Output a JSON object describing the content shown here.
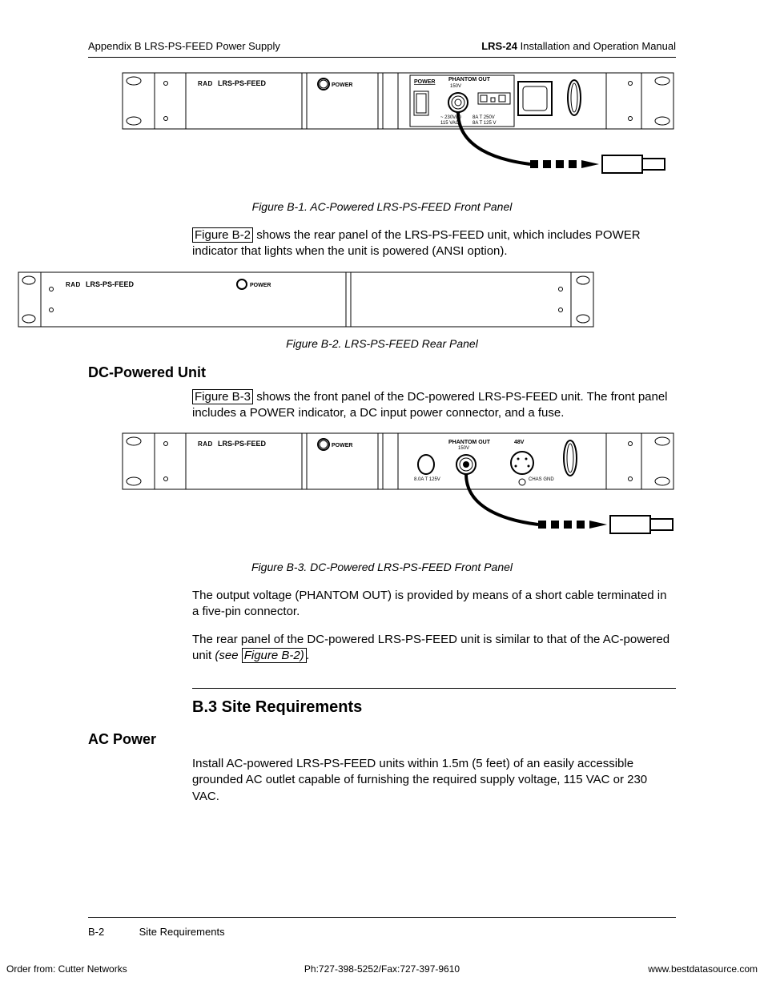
{
  "header": {
    "left_prefix": "Appendix B  ",
    "left_title": "LRS-PS-FEED Power Supply",
    "right_bold": "LRS-24",
    "right_rest": " Installation and Operation Manual"
  },
  "fig1": {
    "caption": "Figure B-1.  AC-Powered LRS-PS-FEED Front Panel",
    "labels": {
      "brand": "RAD",
      "model": "LRS-PS-FEED",
      "power": "POWER",
      "power2": "POWER",
      "phantom": "PHANTOM OUT",
      "phantom_v": "150V",
      "v_left": "~ 230V/ 0",
      "v_left2": "115 VAC/",
      "a_mid": "8A T 250V",
      "a_mid2": "8A T 125 V"
    }
  },
  "para1_link": "Figure B-2",
  "para1_rest": " shows the rear panel of the LRS-PS-FEED unit, which includes POWER indicator that lights when the unit is powered (ANSI option).",
  "fig2": {
    "caption": "Figure B-2.  LRS-PS-FEED Rear Panel",
    "labels": {
      "brand": "RAD",
      "model": "LRS-PS-FEED",
      "power": "POWER"
    }
  },
  "h_dc": "DC-Powered Unit",
  "para2_link": "Figure B-3",
  "para2_rest": " shows the front panel of the DC-powered LRS-PS-FEED unit. The front panel includes a POWER indicator, a DC input power connector, and a fuse.",
  "fig3": {
    "caption": "Figure B-3.  DC-Powered LRS-PS-FEED Front Panel",
    "labels": {
      "brand": "RAD",
      "model": "LRS-PS-FEED",
      "power": "POWER",
      "phantom": "PHANTOM OUT",
      "phantom_v": "150V",
      "dc_v": "48V",
      "fuse": "8.0A T 125V",
      "cgnd": "CHAS GND"
    }
  },
  "para3": "The output voltage (PHANTOM OUT) is provided by means of a short cable terminated in a five-pin connector.",
  "para4_a": "The rear panel of the DC-powered LRS-PS-FEED unit is similar to that of the AC-powered unit ",
  "para4_ital_a": "(see ",
  "para4_link": "Figure B-2)",
  "para4_ital_b": ".",
  "section_b3": "B.3  Site Requirements",
  "h_ac": "AC Power",
  "para5": "Install AC-powered LRS-PS-FEED units within 1.5m (5 feet) of an easily accessible grounded AC outlet capable of furnishing the required supply voltage, 115 VAC or 230 VAC.",
  "footer": {
    "page": "B-2",
    "section": "Site Requirements"
  },
  "orderline": {
    "left": "Order from: Cutter Networks",
    "center": "Ph:727-398-5252/Fax:727-397-9610",
    "right": "www.bestdatasource.com"
  }
}
